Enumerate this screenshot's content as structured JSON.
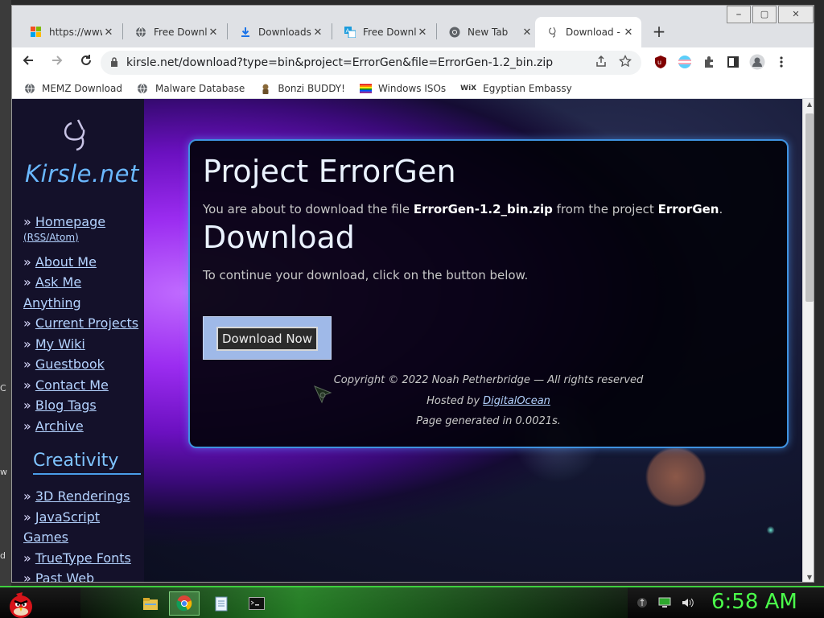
{
  "desktop": {
    "edge_fragments": [
      "C",
      "w",
      "d"
    ]
  },
  "browser": {
    "tabs": [
      {
        "title": "https://www",
        "icon": "windows-icon",
        "active": false
      },
      {
        "title": "Free Downlo",
        "icon": "globe-icon",
        "active": false
      },
      {
        "title": "Downloads",
        "icon": "download-icon",
        "active": false
      },
      {
        "title": "Free Downlo",
        "icon": "translate-icon",
        "active": false
      },
      {
        "title": "New Tab",
        "icon": "chrome-icon",
        "active": false
      },
      {
        "title": "Download -",
        "icon": "kirsle-icon",
        "active": true
      }
    ],
    "tab_close_glyph": "✕",
    "new_tab_glyph": "+",
    "window_controls": [
      "⎯",
      "▢",
      "✕"
    ],
    "url": "kirsle.net/download?type=bin&project=ErrorGen&file=ErrorGen-1.2_bin.zip",
    "bookmarks": [
      {
        "label": "MEMZ Download",
        "icon": "globe-icon"
      },
      {
        "label": "Malware Database",
        "icon": "globe-icon"
      },
      {
        "label": "Bonzi BUDDY!",
        "icon": "bonzi-icon"
      },
      {
        "label": "Windows ISOs",
        "icon": "rainbow-flag-icon"
      },
      {
        "label": "Egyptian Embassy",
        "icon": "wix-icon",
        "icon_text": "WiX"
      }
    ]
  },
  "site": {
    "logo_text": "Kirsle.net",
    "nav": [
      {
        "prefix": "» ",
        "label": "Homepage"
      },
      {
        "label": "(RSS/Atom)",
        "small": true
      },
      {
        "prefix": "» ",
        "label": "About Me"
      },
      {
        "prefix": "» ",
        "label": "Ask Me Anything"
      },
      {
        "prefix": "» ",
        "label": "Current Projects"
      },
      {
        "prefix": "» ",
        "label": "My Wiki"
      },
      {
        "prefix": "» ",
        "label": "Guestbook"
      },
      {
        "prefix": "» ",
        "label": "Contact Me"
      },
      {
        "prefix": "» ",
        "label": "Blog Tags"
      },
      {
        "prefix": "» ",
        "label": "Archive"
      }
    ],
    "section_creativity": "Creativity",
    "nav2": [
      {
        "prefix": "» ",
        "label": "3D Renderings"
      },
      {
        "prefix": "» ",
        "label": "JavaScript"
      },
      {
        "prefix": "",
        "label": "Games"
      },
      {
        "prefix": "» ",
        "label": "TrueType Fonts"
      },
      {
        "prefix": "» ",
        "label": "Past Web"
      }
    ],
    "panel": {
      "title": "Project ErrorGen",
      "intro_pre": "You are about to download the file ",
      "file_name": "ErrorGen-1.2_bin.zip",
      "intro_mid": " from the project ",
      "project_name": "ErrorGen",
      "intro_post": ".",
      "subtitle": "Download",
      "instructions": "To continue your download, click on the button below.",
      "button_label": "Download Now",
      "copyright": "Copyright © 2022 Noah Petherbridge — All rights reserved",
      "hosted_pre": "Hosted by ",
      "hosted_link": "DigitalOcean",
      "generated": "Page generated in 0.0021s."
    }
  },
  "taskbar": {
    "clock": "6:58 AM",
    "apps": [
      "file-explorer-icon",
      "chrome-icon",
      "notepad-icon",
      "terminal-icon"
    ],
    "active_app": "chrome-icon",
    "tray_icons": [
      "usb-icon",
      "network-icon",
      "volume-icon"
    ]
  },
  "colors": {
    "accent_blue": "#3f92e0",
    "clock_green": "#4bff4b",
    "logo_blue": "#6ab8ff",
    "link": "#b4d3ff"
  }
}
